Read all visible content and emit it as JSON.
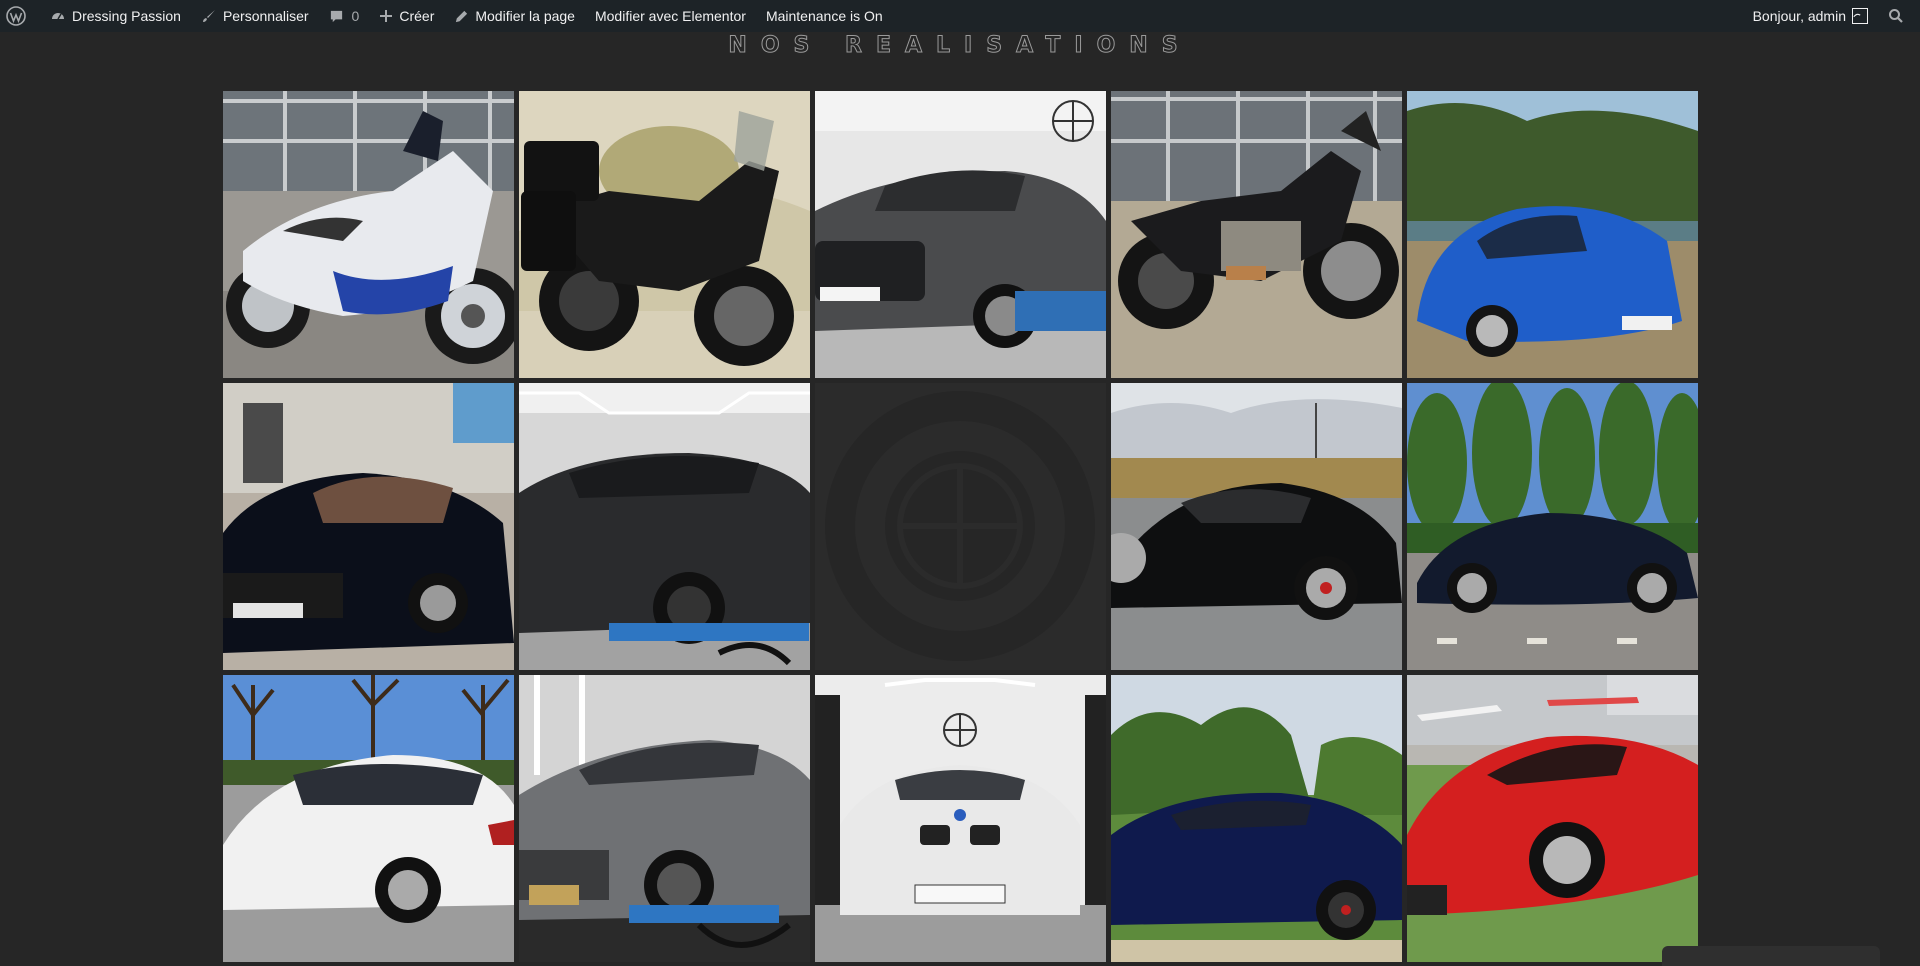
{
  "admin_bar": {
    "site_name": "Dressing Passion",
    "customize": "Personnaliser",
    "comments_count": "0",
    "new": "Créer",
    "edit_page": "Modifier la page",
    "edit_elementor": "Modifier avec Elementor",
    "maintenance": "Maintenance is On",
    "greeting": "Bonjour, admin"
  },
  "section": {
    "title": "NOS REALISATIONS"
  },
  "gallery": {
    "items": [
      {
        "subject": "white-blue Honda VFR motorcycle"
      },
      {
        "subject": "black Triumph adventure motorcycle"
      },
      {
        "subject": "grey Porsche Macan in studio"
      },
      {
        "subject": "black Triumph Rocket motorcycle"
      },
      {
        "subject": "blue Alpine A110"
      },
      {
        "subject": "black Maserati Ghibli"
      },
      {
        "subject": "black Range Rover Velar in studio"
      },
      {
        "subject": "Dressing Passion logo placeholder"
      },
      {
        "subject": "black Porsche Cayman"
      },
      {
        "subject": "dark blue BMW 4 Gran Coupé"
      },
      {
        "subject": "white BMW 1 series"
      },
      {
        "subject": "grey Renault Megane E-Tech in studio"
      },
      {
        "subject": "white BMW 2 series convertible"
      },
      {
        "subject": "dark blue coupé in countryside"
      },
      {
        "subject": "red Ferrari F8"
      }
    ]
  },
  "colors": {
    "background": "#262626",
    "admin_bar": "#1d2327"
  }
}
